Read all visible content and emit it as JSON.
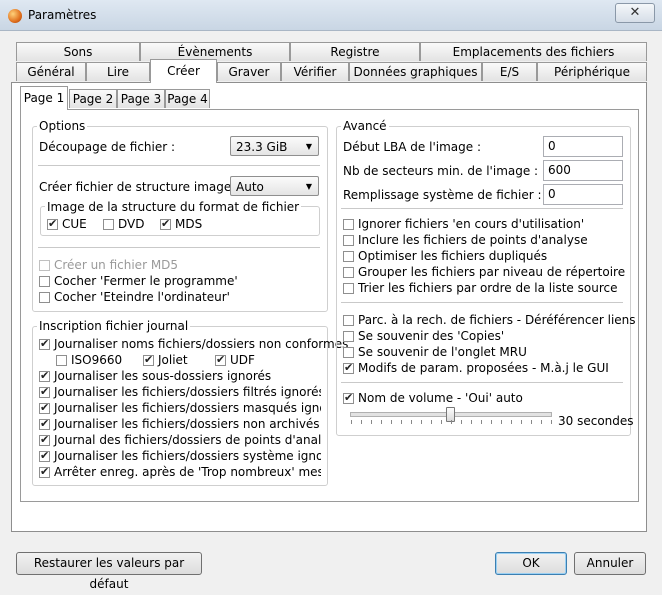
{
  "window": {
    "title": "Paramètres",
    "close_glyph": "✕"
  },
  "tabs_row1": [
    "Sons",
    "Évènements",
    "Registre",
    "Emplacements des fichiers"
  ],
  "tabs_row2": [
    "Général",
    "Lire",
    "Créer",
    "Graver",
    "Vérifier",
    "Données graphiques",
    "E/S",
    "Périphérique"
  ],
  "subtabs": [
    "Page 1",
    "Page 2",
    "Page 3",
    "Page 4"
  ],
  "options": {
    "legend": "Options",
    "split_label": "Découpage de fichier :",
    "split_value": "23.3 GiB",
    "struct_label": "Créer fichier de structure image :",
    "struct_value": "Auto",
    "format_legend": "Image de la structure du format de fichier",
    "formats": [
      {
        "label": "CUE",
        "checked": true
      },
      {
        "label": "DVD",
        "checked": false
      },
      {
        "label": "MDS",
        "checked": true
      }
    ],
    "md5": {
      "label": "Créer un fichier MD5",
      "checked": false
    },
    "close_prog": {
      "label": "Cocher 'Fermer le programme'",
      "checked": false
    },
    "shutdown": {
      "label": "Cocher 'Eteindre l'ordinateur'",
      "checked": false
    }
  },
  "log": {
    "legend": "Inscription fichier journal",
    "nonconform": {
      "label": "Journaliser noms fichiers/dossiers non conformes",
      "checked": true
    },
    "iso": {
      "label": "ISO9660",
      "checked": false
    },
    "joliet": {
      "label": "Joliet",
      "checked": true
    },
    "udf": {
      "label": "UDF",
      "checked": true
    },
    "items": [
      {
        "label": "Journaliser les sous-dossiers ignorés",
        "checked": true
      },
      {
        "label": "Journaliser les fichiers/dossiers filtrés ignorés",
        "checked": true
      },
      {
        "label": "Journaliser les fichiers/dossiers masqués ignorés",
        "checked": true
      },
      {
        "label": "Journaliser les fichiers/dossiers non archivés ignorés",
        "checked": true
      },
      {
        "label": "Journal des fichiers/dossiers de points d'analyse ignorés",
        "checked": true
      },
      {
        "label": "Journaliser les fichiers/dossiers système ignorés",
        "checked": true
      },
      {
        "label": "Arrêter enreg. après de 'Trop nombreux' messages",
        "checked": true
      }
    ]
  },
  "advanced": {
    "legend": "Avancé",
    "lba_label": "Début LBA de l'image :",
    "lba_value": "0",
    "sectors_label": "Nb de secteurs min. de l'image :",
    "sectors_value": "600",
    "fill_label": "Remplissage système de fichier :",
    "fill_value": "0",
    "group1": [
      {
        "label": "Ignorer fichiers 'en cours d'utilisation'",
        "checked": false
      },
      {
        "label": "Inclure les fichiers de points d'analyse",
        "checked": false
      },
      {
        "label": "Optimiser les fichiers dupliqués",
        "checked": false
      },
      {
        "label": "Grouper les fichiers par niveau de répertoire",
        "checked": false
      },
      {
        "label": "Trier les fichiers par ordre de la liste source",
        "checked": false
      }
    ],
    "group2": [
      {
        "label": "Parc. à la rech. de fichiers - Déréférencer liens",
        "checked": false
      },
      {
        "label": "Se souvenir des 'Copies'",
        "checked": false
      },
      {
        "label": "Se souvenir de l'onglet MRU",
        "checked": false
      },
      {
        "label": "Modifs de param. proposées - M.à.j le GUI",
        "checked": true
      }
    ],
    "volume": {
      "label": "Nom de volume - 'Oui' auto",
      "checked": true
    },
    "slider_value_label": "30 secondes"
  },
  "footer": {
    "restore": "Restaurer les valeurs par défaut",
    "ok": "OK",
    "cancel": "Annuler"
  }
}
